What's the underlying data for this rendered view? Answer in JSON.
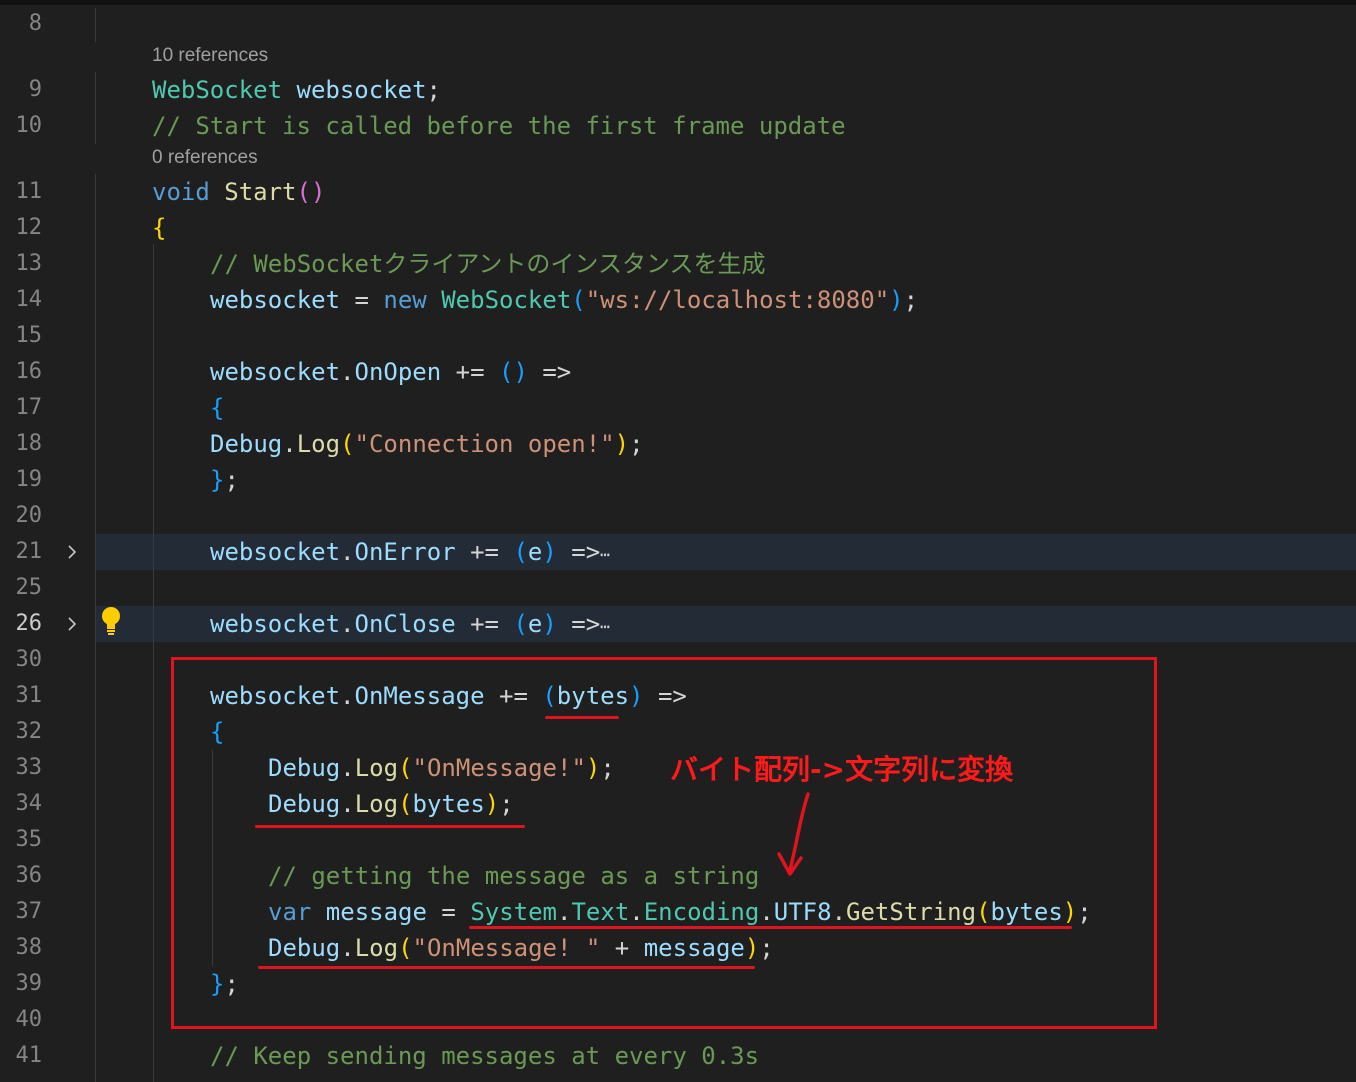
{
  "editor": {
    "codelens": {
      "websocket_refs": "10 references",
      "start_refs": "0 references"
    },
    "line_numbers": [
      "8",
      "9",
      "10",
      "11",
      "12",
      "13",
      "14",
      "15",
      "16",
      "17",
      "18",
      "19",
      "20",
      "21",
      "25",
      "26",
      "30",
      "31",
      "32",
      "33",
      "34",
      "35",
      "36",
      "37",
      "38",
      "39",
      "40",
      "41"
    ],
    "lines": {
      "l9": [
        "WebSocket",
        " websocket",
        ";"
      ],
      "l10": "// Start is called before the first frame update",
      "l11": [
        "void",
        " ",
        "Start",
        "(",
        ")"
      ],
      "l12": "{",
      "l13": "// WebSocketクライアントのインスタンスを生成",
      "l14": [
        "websocket",
        " = ",
        "new",
        " ",
        "WebSocket",
        "(",
        "\"ws://localhost:8080\"",
        ")",
        ";"
      ],
      "l16": [
        "websocket",
        ".",
        "OnOpen",
        " += ",
        "()",
        " =>"
      ],
      "l17": "{",
      "l18": [
        "Debug",
        ".",
        "Log",
        "(",
        "\"Connection open!\"",
        ")",
        ";"
      ],
      "l19": [
        "}",
        ";"
      ],
      "l21": [
        "websocket",
        ".",
        "OnError",
        " += ",
        "(",
        "e",
        ")",
        " =>",
        "⋯"
      ],
      "l26": [
        "websocket",
        ".",
        "OnClose",
        " += ",
        "(",
        "e",
        ")",
        " =>",
        "⋯"
      ],
      "l31": [
        "websocket",
        ".",
        "OnMessage",
        " += ",
        "(",
        "bytes",
        ")",
        " =>"
      ],
      "l32": "{",
      "l33": [
        "Debug",
        ".",
        "Log",
        "(",
        "\"OnMessage!\"",
        ")",
        ";"
      ],
      "l34": [
        "Debug",
        ".",
        "Log",
        "(",
        "bytes",
        ")",
        ";"
      ],
      "l36": "// getting the message as a string",
      "l37": [
        "var",
        " message",
        " = ",
        "System",
        ".",
        "Text",
        ".",
        "Encoding",
        ".",
        "UTF8",
        ".",
        "GetString",
        "(",
        "bytes",
        ")",
        ";"
      ],
      "l38": [
        "Debug",
        ".",
        "Log",
        "(",
        "\"OnMessage! \"",
        " + ",
        "message",
        ")",
        ";"
      ],
      "l39": [
        "}",
        ";"
      ],
      "l41": "// Keep sending messages at every 0.3s"
    }
  },
  "annotation": {
    "text": "バイト配列->文字列に変換",
    "color": "#e0141e"
  },
  "colors": {
    "background": "#1f1f1f",
    "keyword": "#569cd6",
    "type": "#4ec9b0",
    "function": "#dcdcaa",
    "string": "#ce9178",
    "comment": "#6a9955",
    "variable": "#9cdcfe"
  },
  "icons": {
    "fold": "chevron-right-icon",
    "lightbulb": "lightbulb-icon"
  }
}
